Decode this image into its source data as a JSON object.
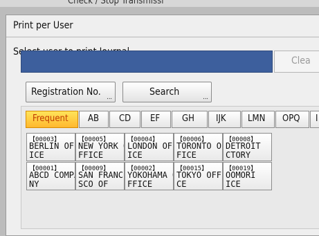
{
  "background_window": {
    "title": "Check / Stop Transmissi"
  },
  "dialog": {
    "title": "Print per User",
    "instruction": "Select user to print Journal.",
    "clear_label": "Clea"
  },
  "buttons": {
    "registration_label": "Registration No.",
    "search_label": "Search",
    "dots": "..."
  },
  "tabs": [
    "Frequent",
    "AB",
    "CD",
    "EF",
    "GH",
    "IJK",
    "LMN",
    "OPQ",
    "I"
  ],
  "users": [
    {
      "num": "【00003】",
      "name": "BERLIN OFF\nICE"
    },
    {
      "num": "【00005】",
      "name": "NEW YORK O\nFFICE"
    },
    {
      "num": "【00004】",
      "name": "LONDON OFF\nICE"
    },
    {
      "num": "【00006】",
      "name": "TORONTO OF\nFICE"
    },
    {
      "num": "【00008】",
      "name": "DETROIT\nCTORY"
    },
    {
      "num": "【00001】",
      "name": "ABCD COMPA\nNY"
    },
    {
      "num": "【00009】",
      "name": "SAN FRANCI\nSCO OF"
    },
    {
      "num": "【00002】",
      "name": "YOKOHAMA O\nFFICE"
    },
    {
      "num": "【00015】",
      "name": "TOKYO OFFI\nCE"
    },
    {
      "num": "【00019】",
      "name": "OOMORI\nICE"
    }
  ],
  "colors": {
    "accent_blue": "#3d5f9d",
    "active_tab": "#ffb82e"
  }
}
